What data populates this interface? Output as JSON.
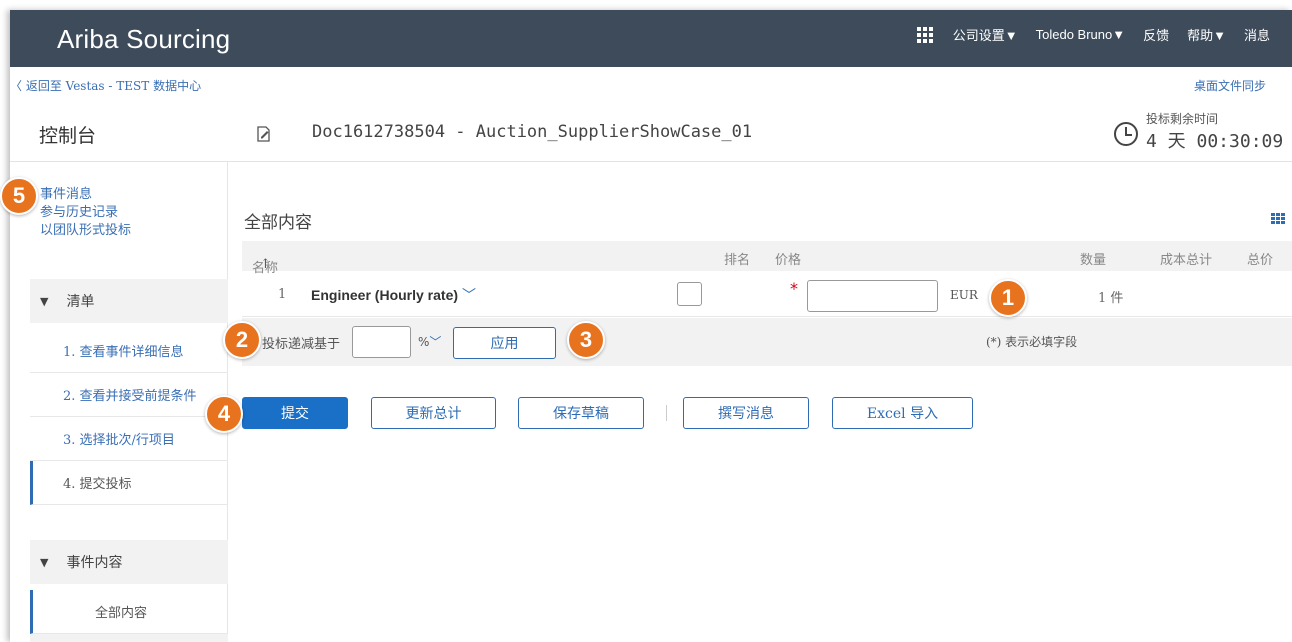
{
  "topbar": {
    "brand": "Ariba Sourcing",
    "company_settings": "公司设置▼",
    "user": "Toledo Bruno▼",
    "feedback": "反馈",
    "help": "帮助▼",
    "messages": "消息",
    "apps_icon": "grid-icon"
  },
  "subbar": {
    "back_link": "〈 返回至 Vestas - TEST 数据中心",
    "desktop_sync": "桌面文件同步"
  },
  "header": {
    "console_title": "控制台",
    "doc_title": "Doc1612738504 - Auction_SupplierShowCase_01",
    "timer_label": "投标剩余时间",
    "timer_value": "4 天 00:30:09"
  },
  "sidebar": {
    "links": [
      "事件消息",
      "参与历史记录",
      "以团队形式投标"
    ],
    "checklist_label": "清单",
    "steps": [
      "1. 查看事件详细信息",
      "2. 查看并接受前提条件",
      "3. 选择批次/行项目",
      "4. 提交投标"
    ],
    "event_content_label": "事件内容",
    "event_content_item": "全部内容"
  },
  "main": {
    "title": "全部内容",
    "columns": {
      "name": "名称",
      "sort_arrow": "↑",
      "rank": "排名",
      "price": "价格",
      "quantity": "数量",
      "total_cost": "成本总计",
      "total_price": "总价"
    },
    "row": {
      "number": "1",
      "item": "Engineer (Hourly rate)",
      "currency": "EUR",
      "quantity": "1 件"
    },
    "decrement": {
      "label": "投标递减基于",
      "unit": "%",
      "apply": "应用",
      "required_note": "(*) 表示必填字段"
    },
    "buttons": {
      "submit": "提交",
      "update_totals": "更新总计",
      "save_draft": "保存草稿",
      "compose_message": "撰写消息",
      "excel_import": "Excel 导入"
    }
  },
  "annotations": [
    "1",
    "2",
    "3",
    "4",
    "5"
  ],
  "colors": {
    "topbar": "#3d4b5b",
    "link": "#3a6fb4",
    "primary": "#1a6fc7",
    "badge": "#e8731f",
    "required": "#d0021b"
  }
}
